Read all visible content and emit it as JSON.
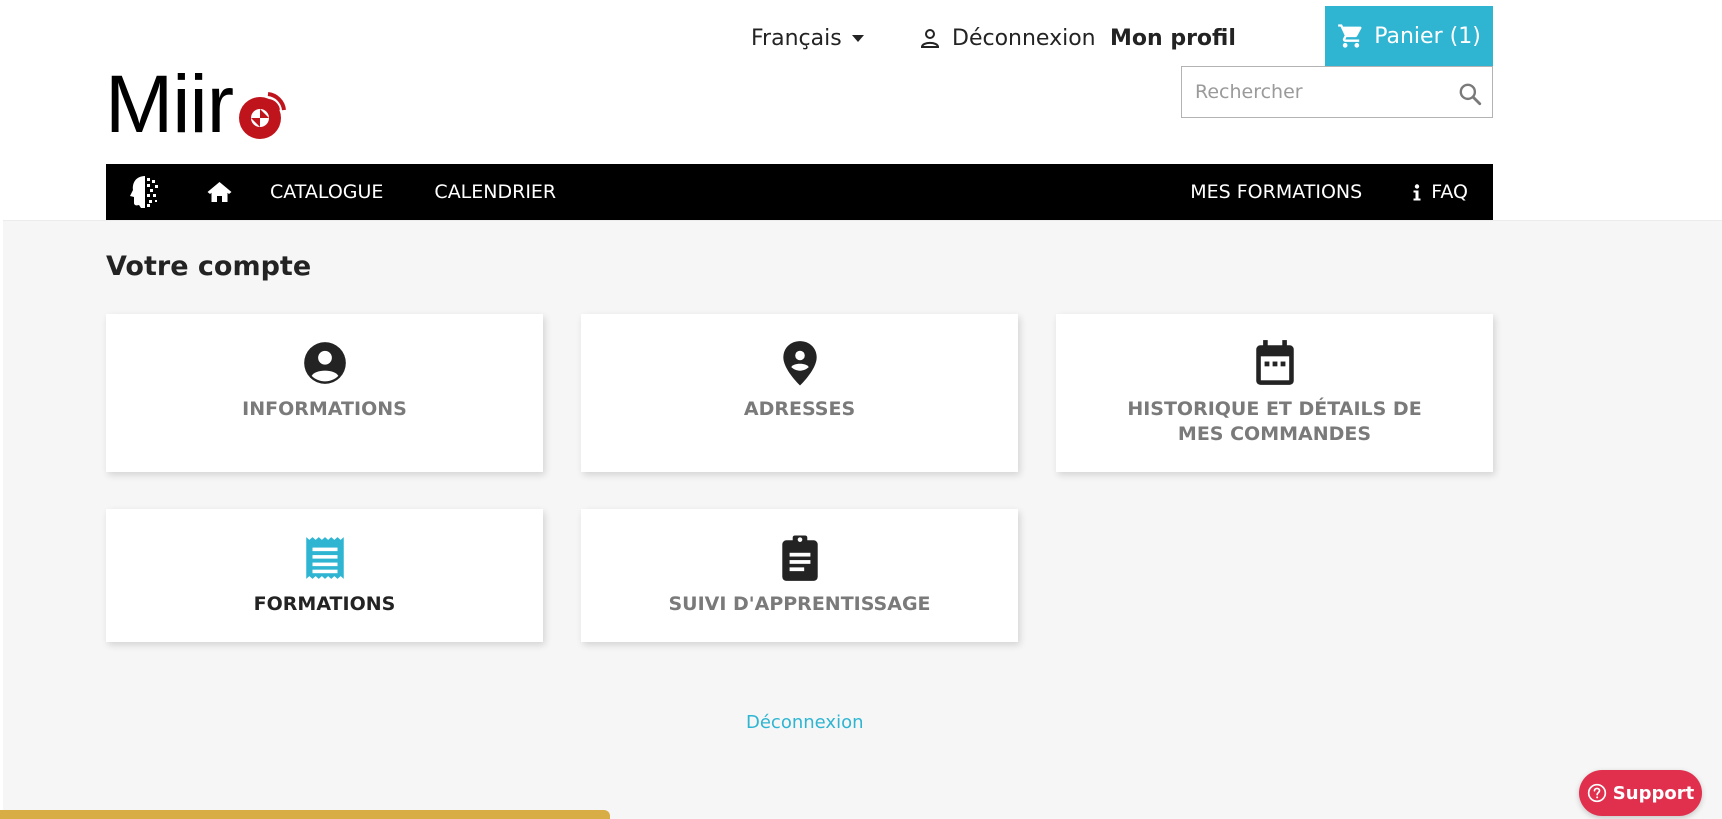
{
  "header": {
    "logo_text": "Miir",
    "language": "Français",
    "logout_label": "Déconnexion",
    "profile_label": "Mon profil",
    "cart_label": "Panier (1)",
    "search_placeholder": "Rechercher"
  },
  "nav": {
    "items": [
      "CATALOGUE",
      "CALENDRIER",
      "MES FORMATIONS",
      "FAQ"
    ]
  },
  "main": {
    "title": "Votre compte",
    "cards": [
      {
        "label": "INFORMATIONS",
        "icon": "account-circle-icon"
      },
      {
        "label": "ADRESSES",
        "icon": "map-pin-icon"
      },
      {
        "label": "HISTORIQUE ET DÉTAILS DE MES COMMANDES",
        "icon": "calendar-icon"
      },
      {
        "label": "FORMATIONS",
        "icon": "receipt-icon",
        "active": true
      },
      {
        "label": "SUIVI D'APPRENTISSAGE",
        "icon": "clipboard-icon"
      }
    ],
    "logout_link": "Déconnexion"
  },
  "support": {
    "label": "Support"
  },
  "colors": {
    "accent": "#2fb5d2",
    "nav_bg": "#000000",
    "support": "#e0304d",
    "logo_red": "#c0141c",
    "gold": "#d9ad45"
  }
}
